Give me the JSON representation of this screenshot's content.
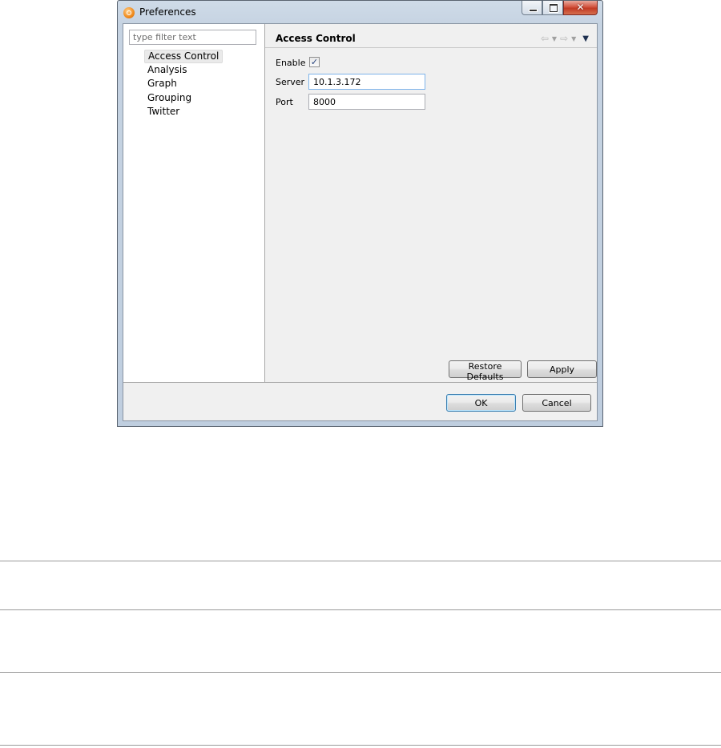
{
  "window": {
    "title": "Preferences",
    "buttons": {
      "minimize": "minimize",
      "maximize": "maximize",
      "close": "✕"
    }
  },
  "nav": {
    "filter_placeholder": "type filter text",
    "items": [
      "Access Control",
      "Analysis",
      "Graph",
      "Grouping",
      "Twitter"
    ],
    "selected": "Access Control"
  },
  "page": {
    "title": "Access Control",
    "enable": {
      "label": "Enable",
      "checked": true
    },
    "server": {
      "label": "Server",
      "value": "10.1.3.172"
    },
    "port": {
      "label": "Port",
      "value": "8000"
    },
    "restore_defaults_label": "Restore Defaults",
    "apply_label": "Apply"
  },
  "dialog_buttons": {
    "ok_label": "OK",
    "cancel_label": "Cancel"
  },
  "icons": {
    "app": "preferences-app-icon",
    "back": "back-arrow-icon",
    "forward": "forward-arrow-icon",
    "view_menu": "view-menu-icon"
  },
  "colors": {
    "selection": "#eaeaea",
    "default_button_border": "#3c7fb1",
    "close_button": "#c23a24"
  }
}
